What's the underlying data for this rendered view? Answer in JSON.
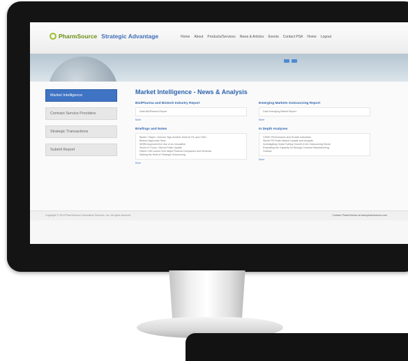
{
  "logo": {
    "part1": "PharmSource",
    "part2": "Strategic Advantage"
  },
  "nav": [
    "Home",
    "About",
    "Products/Services",
    "News & Articles",
    "Events",
    "Contact PSA",
    "Home",
    "Logout"
  ],
  "sidebar": {
    "items": [
      "Market Intelligence",
      "Contract Service Providers",
      "Strategic Transactions",
      "Submit Report"
    ]
  },
  "main": {
    "title": "Market Intelligence - News & Analysis",
    "left": [
      {
        "title": "Bio/Pharma and Biotech Industry Report",
        "box": [
          "Data Bio/Pharma Report"
        ],
        "more": "More"
      },
      {
        "title": "Briefings and Notes",
        "box": [
          "Baxter / Bayer / Unicorn Sign Another Deal for Flu and CMO",
          "Biotech Approvals Slow",
          "MHRA Approves the Use of an Innovative",
          "Sector in Focus: Clinical Trials Update",
          "Patent Cliff Looms Over Major Pharma Companies and Generics",
          "Making the Most of Strategic Outsourcing"
        ],
        "more": "More"
      }
    ],
    "right": [
      {
        "title": "Emerging Markets Outsourcing Report",
        "box": [
          "Data Emerging Market Report"
        ],
        "more": "More"
      },
      {
        "title": "In Depth Analyses",
        "box": [
          "CDMO Performance and Growth Indicators",
          "Sterile Fill Finish Market Update and Analysis",
          "Investigating Deals Fueling Growth in the Outsourcing Sector",
          "Evaluating the Capacity for Biologic Contract Manufacturing",
          "Outlook"
        ],
        "more": "More"
      }
    ]
  },
  "footer": {
    "left": "Copyright © 2013 PharmSource Information Services, Inc. All rights reserved.",
    "right": "Contact: PharmSource at www.pharmsource.com"
  }
}
